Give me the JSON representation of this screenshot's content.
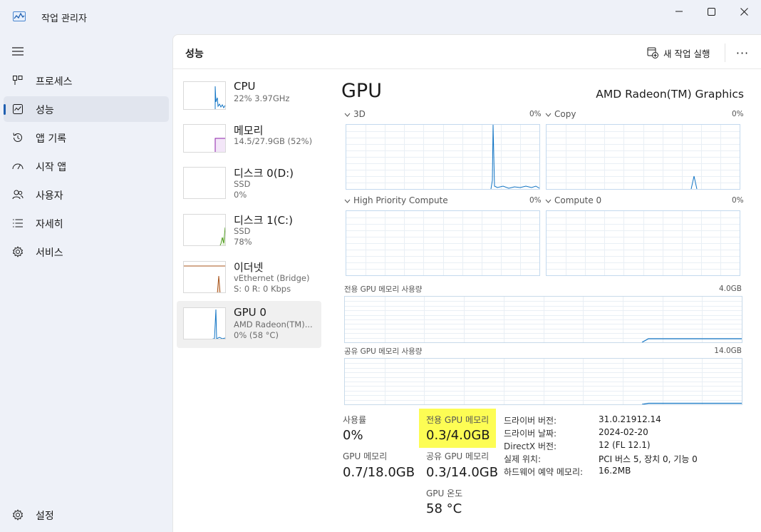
{
  "window": {
    "title": "작업 관리자"
  },
  "nav": {
    "items": [
      {
        "label": "프로세스",
        "icon": "processes-icon"
      },
      {
        "label": "성능",
        "icon": "performance-icon",
        "active": true
      },
      {
        "label": "앱 기록",
        "icon": "app-history-icon"
      },
      {
        "label": "시작 앱",
        "icon": "startup-apps-icon"
      },
      {
        "label": "사용자",
        "icon": "users-icon"
      },
      {
        "label": "자세히",
        "icon": "details-icon"
      },
      {
        "label": "서비스",
        "icon": "services-icon"
      }
    ],
    "settings_label": "설정"
  },
  "header": {
    "title": "성능",
    "run_task_label": "새 작업 실행",
    "more_label": "···"
  },
  "devices": [
    {
      "name": "CPU",
      "sub1": "22%  3.97GHz",
      "sub2": "",
      "sub3": "",
      "color": "#1174c4"
    },
    {
      "name": "메모리",
      "sub1": "14.5/27.9GB (52%)",
      "sub2": "",
      "sub3": "",
      "color": "#8b1fa8"
    },
    {
      "name": "디스크 0(D:)",
      "sub1": "SSD",
      "sub2": "0%",
      "sub3": "",
      "color": "#4d9a1c"
    },
    {
      "name": "디스크 1(C:)",
      "sub1": "SSD",
      "sub2": "78%",
      "sub3": "",
      "color": "#4d9a1c"
    },
    {
      "name": "이더넷",
      "sub1": "vEthernet (Bridge)",
      "sub2": "S: 0  R: 0 Kbps",
      "sub3": "",
      "color": "#a7531a"
    },
    {
      "name": "GPU 0",
      "sub1": "AMD Radeon(TM)...",
      "sub2": "0%  (58 °C)",
      "sub3": "",
      "color": "#1174c4",
      "active": true
    }
  ],
  "gpu": {
    "title": "GPU",
    "model": "AMD Radeon(TM) Graphics",
    "engines": [
      {
        "label": "3D",
        "pct": "0%"
      },
      {
        "label": "Copy",
        "pct": "0%"
      },
      {
        "label": "High Priority Compute",
        "pct": "0%"
      },
      {
        "label": "Compute 0",
        "pct": "0%"
      }
    ],
    "dedicated_graph": {
      "label": "전용 GPU 메모리 사용량",
      "max": "4.0GB"
    },
    "shared_graph": {
      "label": "공유 GPU 메모리 사용량",
      "max": "14.0GB"
    },
    "line_color": "#1174c4",
    "highlight_color": "#fdfd54"
  },
  "stats": {
    "utilization": {
      "label": "사용률",
      "value": "0%"
    },
    "dedicated": {
      "label": "전용 GPU 메모리",
      "value": "0.3/4.0GB"
    },
    "gpu_memory": {
      "label": "GPU 메모리",
      "value": "0.7/18.0GB"
    },
    "shared": {
      "label": "공유 GPU 메모리",
      "value": "0.3/14.0GB"
    },
    "temperature": {
      "label": "GPU 온도",
      "value": "58 °C"
    }
  },
  "info": [
    {
      "key": "드라이버 버전:",
      "value": "31.0.21912.14"
    },
    {
      "key": "드라이버 날짜:",
      "value": "2024-02-20"
    },
    {
      "key": "DirectX 버전:",
      "value": "12 (FL 12.1)"
    },
    {
      "key": "실제 위치:",
      "value": "PCI 버스 5, 장치 0, 기능 0"
    },
    {
      "key": "하드웨어 예약 메모리:",
      "value": "16.2MB"
    }
  ]
}
